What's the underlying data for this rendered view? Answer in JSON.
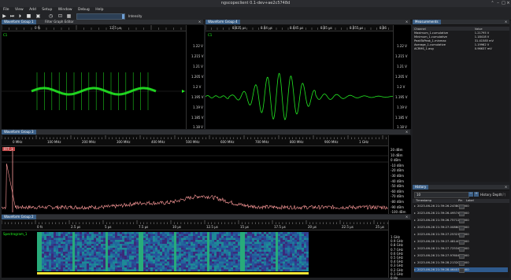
{
  "window": {
    "title": "ngscopeclient 0.1-dev+ae2c5748d",
    "min": "–",
    "max": "□",
    "close": "×",
    "restore": "⌃"
  },
  "menu": [
    "File",
    "View",
    "Add",
    "Setup",
    "Window",
    "Debug",
    "Help"
  ],
  "toolbar": {
    "intensity_label": "Intensity"
  },
  "icons": {
    "play": "▶",
    "skip": "⏭",
    "step": "⏵",
    "stop": "■",
    "save": "▣",
    "timer": "◷",
    "measure": "⊡",
    "grid": "▦"
  },
  "wg1": {
    "tab": "Waveform Group 1",
    "tab2": "Filter Graph Editor",
    "close": "×",
    "ruler": [
      "0 fs",
      "12.5 µs"
    ],
    "channel": "C1",
    "yaxis": [
      "1.22 V",
      "1.215 V",
      "1.21 V",
      "1.205 V",
      "1.2 V",
      "1.195 V",
      "1.19 V",
      "1.185 V",
      "1.18 V"
    ]
  },
  "wg4": {
    "tab": "Waveform Group 4",
    "close": "×",
    "ruler": [
      "8.835 µs",
      "8.84 µs",
      "8.845 µs",
      "8.85 µs",
      "8.855 µs",
      "8.86"
    ],
    "channel": "C1",
    "yaxis": [
      "1.22 V",
      "1.215 V",
      "1.21 V",
      "1.205 V",
      "1.2 V",
      "1.195 V",
      "1.19 V",
      "1.185 V",
      "1.18 V"
    ]
  },
  "wg3": {
    "tab": "Waveform Group 3",
    "close": "×",
    "ruler": [
      "0 MHz",
      "100 MHz",
      "200 MHz",
      "300 MHz",
      "400 MHz",
      "500 MHz",
      "600 MHz",
      "700 MHz",
      "800 MHz",
      "900 MHz",
      "1 GHz"
    ],
    "channel": "FFT_1",
    "yaxis": [
      "20 dBm",
      "10 dBm",
      "0 dBm",
      "-10 dBm",
      "-20 dBm",
      "-30 dBm",
      "-40 dBm",
      "-50 dBm",
      "-60 dBm",
      "-70 dBm",
      "-80 dBm",
      "-90 dBm",
      "-100 dBm"
    ]
  },
  "wg2": {
    "tab": "Waveform Group 2",
    "close": "×",
    "ruler": [
      "0 fs",
      "2.5 µs",
      "5 µs",
      "7.5 µs",
      "10 µs",
      "12.5 µs",
      "15 µs",
      "17.5 µs",
      "20 µs",
      "22.5 µs",
      "25 µs"
    ],
    "channel": "Spectrogram_1",
    "yaxis": [
      "1 GHz",
      "0.9 GHz",
      "0.8 GHz",
      "0.7 GHz",
      "0.6 GHz",
      "0.5 GHz",
      "0.4 GHz",
      "0.3 GHz",
      "0.2 GHz",
      "0.1 GHz",
      "0 Hz"
    ]
  },
  "measurements": {
    "tab": "Measurements",
    "close": "×",
    "headers": [
      "Channel",
      "Value"
    ],
    "rows": [
      [
        "Maximum_1.cumulative",
        "1.21795 V"
      ],
      [
        "Minimum_1.cumulative",
        "1.18418 V"
      ],
      [
        "PeakToPeak_1.minmax",
        "31.41585 mV"
      ],
      [
        "Average_1.cumulative",
        "1.19962 V"
      ],
      [
        "ACRMS_1.avg",
        "0.96637 mV"
      ]
    ]
  },
  "history": {
    "tab": "History",
    "close": "×",
    "depth_value": "10",
    "depth_minus": "−",
    "depth_plus": "+",
    "depth_label": "History Depth",
    "depth_help": "(?)",
    "headers": [
      "Timestamp",
      "Pin",
      "Label"
    ],
    "rows": [
      "2023-06-26 21:39:26.2438001000",
      "2023-06-26 21:39:26.4957460000",
      "2023-06-26 21:39:26.7571224000",
      "2023-06-26 21:39:27.0086000000",
      "2023-06-26 21:39:27.2532165000",
      "2023-06-26 21:39:27.4814003000",
      "2023-06-26 21:39:27.7253468000",
      "2023-06-26 21:39:27.9760420000",
      "2023-06-26 21:39:28.2132092000",
      "2023-06-26 21:39:28.4640327000"
    ]
  },
  "colors": {
    "accent": "#3b5f86",
    "wave": "#22e822",
    "fft": "#ff9b9b",
    "selected": "#2f5a8c"
  }
}
